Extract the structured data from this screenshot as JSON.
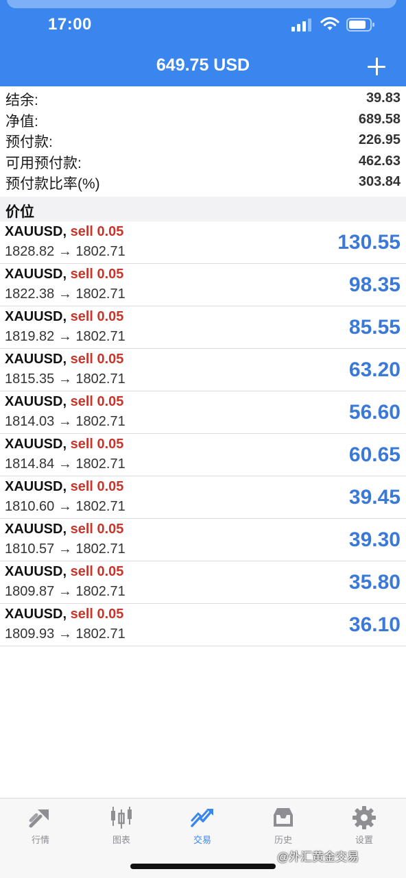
{
  "status_bar": {
    "time": "17:00"
  },
  "header": {
    "title": "649.75 USD",
    "add_icon": "plus-icon"
  },
  "account": [
    {
      "label": "结余:",
      "value": "39.83"
    },
    {
      "label": "净值:",
      "value": "689.58"
    },
    {
      "label": "预付款:",
      "value": "226.95"
    },
    {
      "label": "可用预付款:",
      "value": "462.63"
    },
    {
      "label": "预付款比率(%)",
      "value": "303.84"
    }
  ],
  "section": {
    "title": "价位"
  },
  "trades": [
    {
      "symbol": "XAUUSD,",
      "type": "sell 0.05",
      "prices": "1828.82 → 1802.71",
      "profit": "130.55"
    },
    {
      "symbol": "XAUUSD,",
      "type": "sell 0.05",
      "prices": "1822.38 → 1802.71",
      "profit": "98.35"
    },
    {
      "symbol": "XAUUSD,",
      "type": "sell 0.05",
      "prices": "1819.82 → 1802.71",
      "profit": "85.55"
    },
    {
      "symbol": "XAUUSD,",
      "type": "sell 0.05",
      "prices": "1815.35 → 1802.71",
      "profit": "63.20"
    },
    {
      "symbol": "XAUUSD,",
      "type": "sell 0.05",
      "prices": "1814.03 → 1802.71",
      "profit": "56.60"
    },
    {
      "symbol": "XAUUSD,",
      "type": "sell 0.05",
      "prices": "1814.84 → 1802.71",
      "profit": "60.65"
    },
    {
      "symbol": "XAUUSD,",
      "type": "sell 0.05",
      "prices": "1810.60 → 1802.71",
      "profit": "39.45"
    },
    {
      "symbol": "XAUUSD,",
      "type": "sell 0.05",
      "prices": "1810.57 → 1802.71",
      "profit": "39.30"
    },
    {
      "symbol": "XAUUSD,",
      "type": "sell 0.05",
      "prices": "1809.87 → 1802.71",
      "profit": "35.80"
    },
    {
      "symbol": "XAUUSD,",
      "type": "sell 0.05",
      "prices": "1809.93 → 1802.71",
      "profit": "36.10"
    }
  ],
  "tabs": [
    {
      "label": "行情",
      "icon": "quotes-icon",
      "active": false
    },
    {
      "label": "图表",
      "icon": "candlestick-chart-icon",
      "active": false
    },
    {
      "label": "交易",
      "icon": "trade-trend-icon",
      "active": true
    },
    {
      "label": "历史",
      "icon": "history-inbox-icon",
      "active": false
    },
    {
      "label": "设置",
      "icon": "settings-gear-icon",
      "active": false
    }
  ],
  "watermark": "@外汇黄金交易",
  "colors": {
    "brand_blue": "#3a86ee",
    "sell_red": "#c8352b",
    "profit_blue": "#3a79d8",
    "tab_inactive": "#8e8e93"
  }
}
